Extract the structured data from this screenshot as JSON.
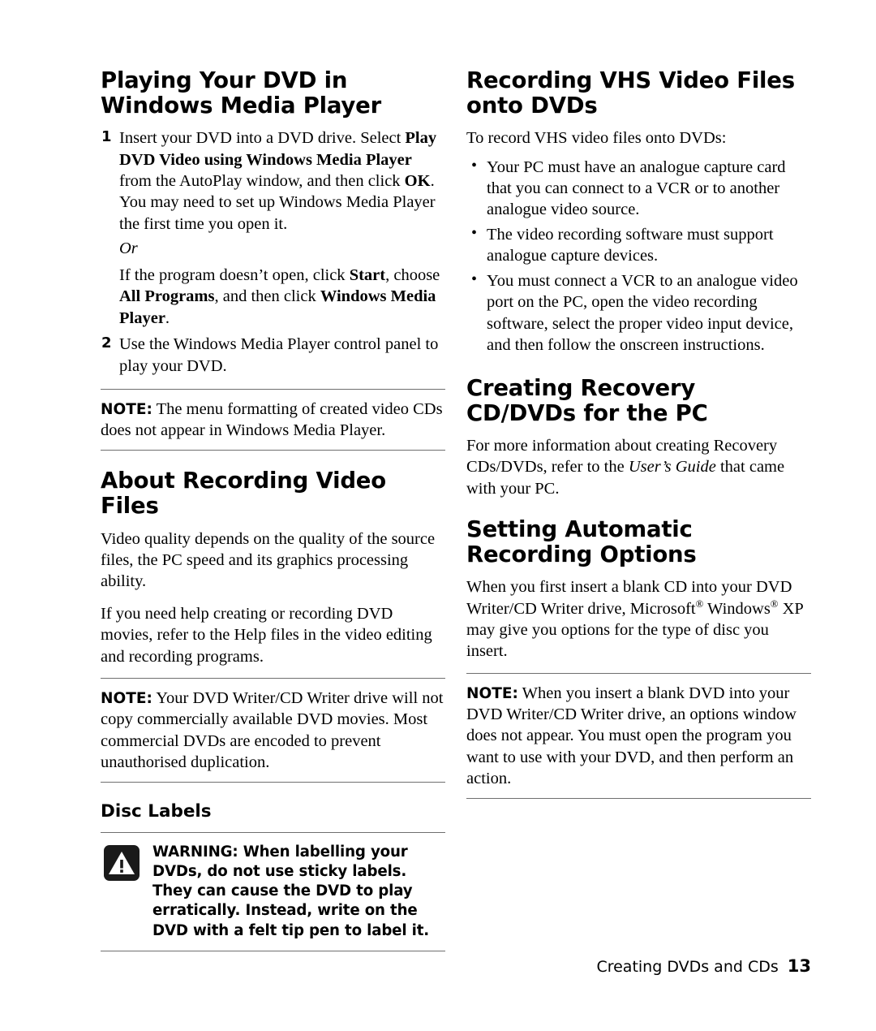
{
  "document": {
    "footer_text": "Creating DVDs and CDs",
    "page_number": "13"
  },
  "left_column": {
    "heading_playing_dvd": "Playing Your DVD in Windows Media Player",
    "steps": [
      {
        "marker": "1",
        "text_part1": "Insert your DVD into a DVD drive. Select ",
        "bold1": "Play DVD Video using Windows Media Player",
        "text_part2": " from the AutoPlay window, and then click ",
        "bold2": "OK",
        "text_part3": ". You may need to set up Windows Media Player the first time you open it.",
        "or_label": "Or",
        "alt_part1": "If the program doesn’t open, click ",
        "alt_bold1": "Start",
        "alt_part2": ", choose ",
        "alt_bold2": "All Programs",
        "alt_part3": ", and then click ",
        "alt_bold3": "Windows Media Player",
        "alt_part4": "."
      },
      {
        "marker": "2",
        "text": "Use the Windows Media Player control panel to play your DVD."
      }
    ],
    "note_media_player": {
      "label": "NOTE:",
      "text": " The menu formatting of created video CDs does not appear in Windows Media Player."
    },
    "heading_about_recording": "About Recording Video Files",
    "para_video_quality": "Video quality depends on the quality of the source files, the PC speed and its graphics processing ability.",
    "para_help_files": "If you need help creating or recording DVD movies, refer to the Help files in the video editing and recording programs.",
    "note_dvd_writer": {
      "label": "NOTE:",
      "text": " Your DVD Writer/CD Writer drive will not copy commercially available DVD movies. Most commercial DVDs are encoded to prevent unauthorised duplication."
    },
    "heading_disc_labels": "Disc Labels",
    "warning_labels": {
      "icon": "warning-triangle-icon",
      "text": "WARNING: When labelling your DVDs, do not use sticky labels. They can cause the DVD to play erratically. Instead, write on the DVD with a felt tip pen to label it."
    }
  },
  "right_column": {
    "heading_recording_vhs": "Recording VHS Video Files onto DVDs",
    "intro_vhs": "To record VHS video files onto DVDs:",
    "vhs_bullets": [
      "Your PC must have an analogue capture card that you can connect to a VCR or to another analogue video source.",
      "The video recording software must support analogue capture devices.",
      "You must connect a VCR to an analogue video port on the PC, open the video recording software, select the proper video input device, and then follow the onscreen instructions."
    ],
    "heading_recovery": "Creating Recovery CD/DVDs for the PC",
    "recovery_part1": "For more information about creating Recovery CDs/DVDs, refer to the ",
    "recovery_italic": "User’s Guide",
    "recovery_part2": " that came with your PC.",
    "heading_auto_recording": "Setting Automatic Recording Options",
    "auto_part1": "When you first insert a blank CD into your DVD Writer/CD Writer drive, Microsoft",
    "auto_part2": " Windows",
    "auto_part3": " XP may give you options for the type of disc you insert.",
    "registered_symbol": "®",
    "note_blank_dvd": {
      "label": "NOTE:",
      "text": " When you insert a blank DVD into your DVD Writer/CD Writer drive, an options window does not appear. You must open the program you want to use with your DVD, and then perform an action."
    }
  }
}
